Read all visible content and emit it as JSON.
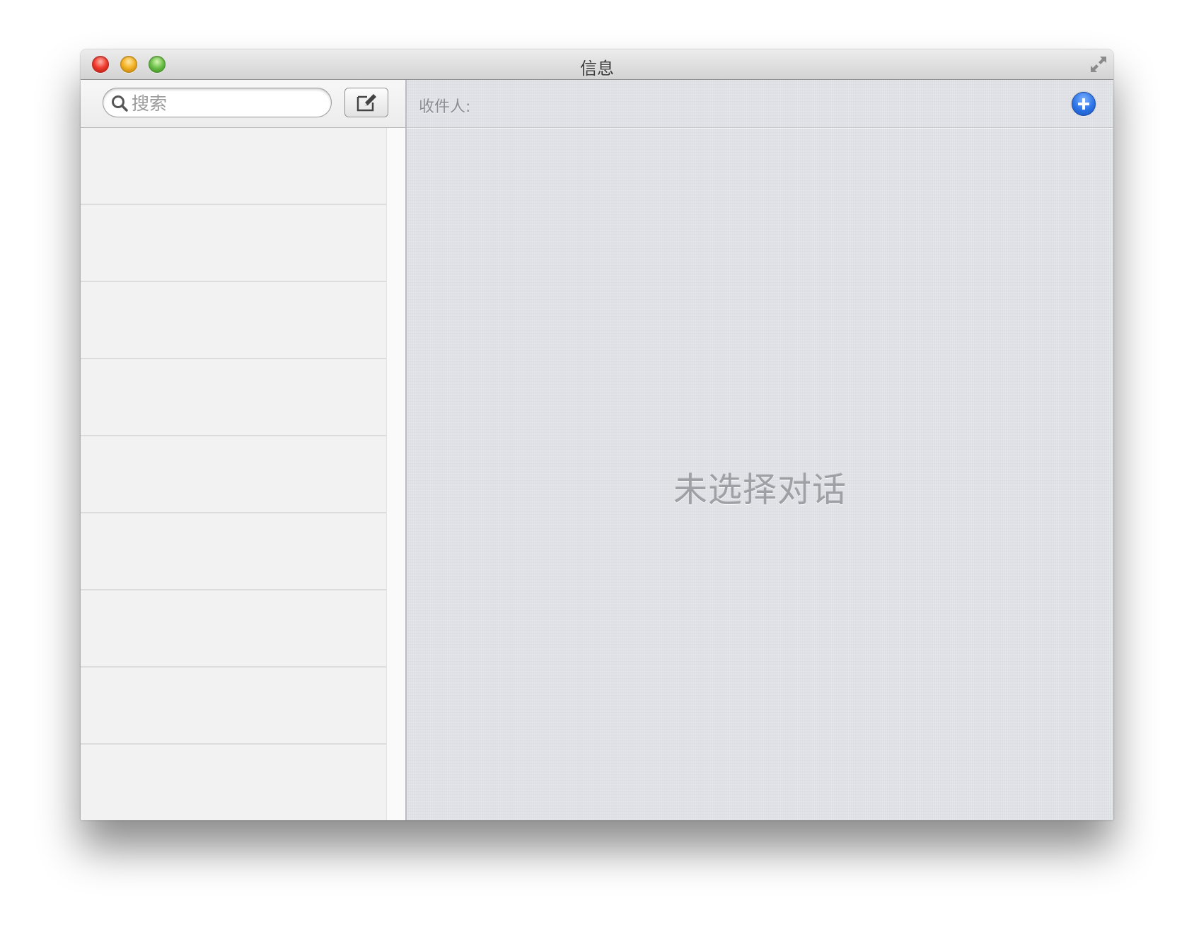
{
  "window": {
    "title": "信息"
  },
  "sidebar": {
    "search": {
      "placeholder": "搜索",
      "value": ""
    },
    "compose_icon": "compose-icon",
    "conversations": [
      {},
      {},
      {},
      {},
      {},
      {},
      {},
      {},
      {}
    ]
  },
  "main": {
    "recipient_label": "收件人:",
    "add_icon": "plus-icon",
    "empty_state": "未选择对话"
  },
  "colors": {
    "accent": "#2b73e6",
    "close": "#ef3b2e",
    "minimize": "#f4b223",
    "zoom": "#6cc04a"
  }
}
